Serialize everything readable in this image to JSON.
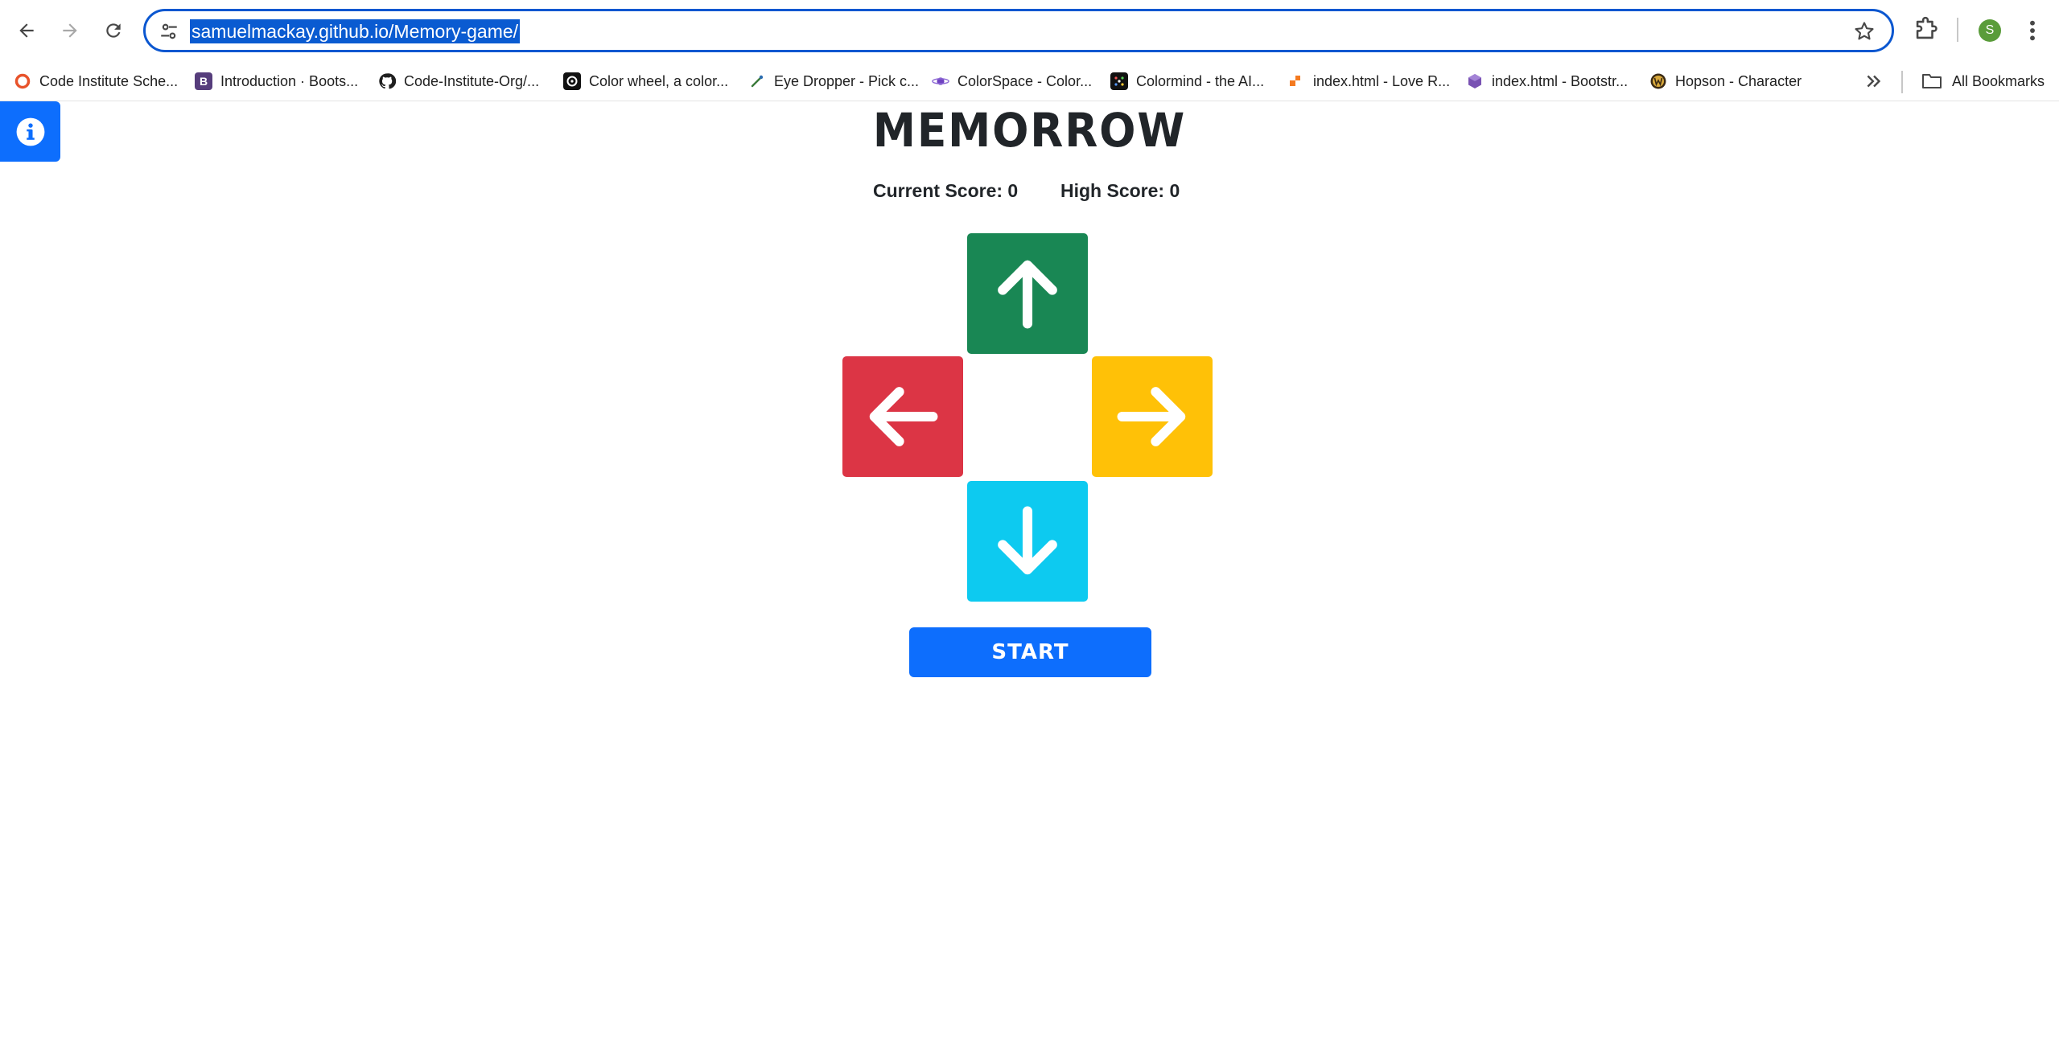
{
  "browser": {
    "url": "samuelmackay.github.io/Memory-game/",
    "profile_initial": "S",
    "accent_color": "#0b57d0",
    "bookmarks": [
      {
        "label": "Code Institute Sche...",
        "icon": "code-institute-icon",
        "color": "#e8532b"
      },
      {
        "label": "Introduction · Boots...",
        "icon": "bootstrap-icon",
        "color": "#563d7c",
        "glyph": "B"
      },
      {
        "label": "Code-Institute-Org/...",
        "icon": "github-icon",
        "color": "#1f1f1f"
      },
      {
        "label": "Color wheel, a color...",
        "icon": "canva-color-icon",
        "color": "#111111"
      },
      {
        "label": "Eye Dropper - Pick c...",
        "icon": "eyedropper-icon",
        "color": "#3a7a3a"
      },
      {
        "label": "ColorSpace - Color...",
        "icon": "colorspace-planet-icon",
        "color": "#6f42c1"
      },
      {
        "label": "Colormind - the AI...",
        "icon": "colormind-icon",
        "color": "#111111"
      },
      {
        "label": "index.html - Love R...",
        "icon": "love-running-icon",
        "color": "#f47a20"
      },
      {
        "label": "index.html - Bootstr...",
        "icon": "bootstrap-cube-icon",
        "color": "#7952b3"
      },
      {
        "label": "Hopson - Character",
        "icon": "hopson-icon",
        "color": "#3b2a14"
      }
    ],
    "all_bookmarks_label": "All Bookmarks"
  },
  "page": {
    "title": "MEMORROW",
    "current_score_label": "Current Score: 0",
    "high_score_label": "High Score: 0",
    "start_label": "START",
    "colors": {
      "up": "#198754",
      "left": "#dc3545",
      "right": "#ffc107",
      "down": "#0dcaf0",
      "primary": "#0d6efd"
    }
  }
}
